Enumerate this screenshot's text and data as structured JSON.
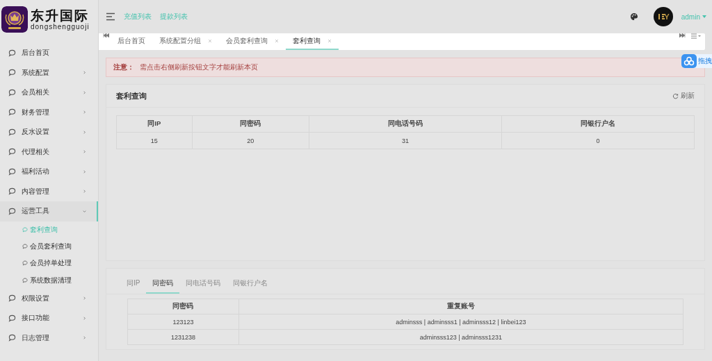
{
  "brand": {
    "title": "东升国际",
    "subtitle": "dongshengguoji"
  },
  "header": {
    "links": [
      "充值列表",
      "提款列表"
    ],
    "user": "admin"
  },
  "sidebar": {
    "items": [
      {
        "label": "后台首页",
        "kind": "link"
      },
      {
        "label": "系统配置",
        "kind": "group",
        "expanded": false
      },
      {
        "label": "会员相关",
        "kind": "group",
        "expanded": false
      },
      {
        "label": "财务管理",
        "kind": "group",
        "expanded": false
      },
      {
        "label": "反水设置",
        "kind": "group",
        "expanded": false
      },
      {
        "label": "代理相关",
        "kind": "group",
        "expanded": false
      },
      {
        "label": "福利活动",
        "kind": "group",
        "expanded": false
      },
      {
        "label": "内容管理",
        "kind": "group",
        "expanded": false
      },
      {
        "label": "运营工具",
        "kind": "group",
        "expanded": true,
        "children": [
          {
            "label": "套利查询",
            "selected": true
          },
          {
            "label": "会员套利查询",
            "selected": false
          },
          {
            "label": "会员掉单处理",
            "selected": false
          },
          {
            "label": "系统数据清理",
            "selected": false
          }
        ]
      },
      {
        "label": "权限设置",
        "kind": "group",
        "expanded": false
      },
      {
        "label": "接口功能",
        "kind": "group",
        "expanded": false
      },
      {
        "label": "日志管理",
        "kind": "group",
        "expanded": false
      }
    ]
  },
  "tabs": [
    {
      "label": "后台首页",
      "closable": false,
      "selected": false
    },
    {
      "label": "系统配置分组",
      "closable": true,
      "selected": false
    },
    {
      "label": "会员套利查询",
      "closable": true,
      "selected": false
    },
    {
      "label": "套利查询",
      "closable": true,
      "selected": true
    }
  ],
  "float_button": "拖拽",
  "notice": {
    "label": "注意：",
    "text": "需点击右侧刷新按钮文字才能刷新本页"
  },
  "summary": {
    "title": "套利查询",
    "refresh": "刷新",
    "columns": [
      "同IP",
      "同密码",
      "同电话号码",
      "同银行户名"
    ],
    "rows": [
      [
        "15",
        "20",
        "31",
        "0"
      ]
    ]
  },
  "detail": {
    "tabs": [
      {
        "label": "同IP",
        "selected": false
      },
      {
        "label": "同密码",
        "selected": true
      },
      {
        "label": "同电话号码",
        "selected": false
      },
      {
        "label": "同银行户名",
        "selected": false
      }
    ],
    "columns": [
      "同密码",
      "重复账号"
    ],
    "rows": [
      [
        "123123",
        "adminsss | adminsss1 | adminsss12 | linbei123"
      ],
      [
        "1231238",
        "adminsss123 | adminsss1231"
      ]
    ]
  }
}
